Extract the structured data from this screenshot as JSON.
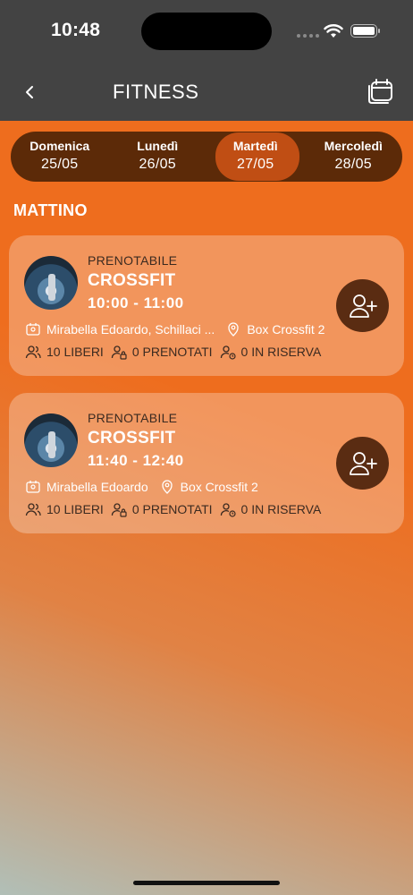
{
  "status_bar": {
    "time": "10:48"
  },
  "header": {
    "title": "FITNESS"
  },
  "days": [
    {
      "name": "Domenica",
      "date": "25/05",
      "active": false
    },
    {
      "name": "Lunedì",
      "date": "26/05",
      "active": false
    },
    {
      "name": "Martedì",
      "date": "27/05",
      "active": true
    },
    {
      "name": "Mercoledì",
      "date": "28/05",
      "active": false
    }
  ],
  "section": {
    "title": "MATTINO"
  },
  "classes": [
    {
      "status": "PRENOTABILE",
      "name": "CROSSFIT",
      "time": "10:00 - 11:00",
      "trainer": "Mirabella Edoardo, Schillaci ...",
      "location": "Box Crossfit 2",
      "free": "10 LIBERI",
      "booked": "0 PRENOTATI",
      "reserve": "0 IN RISERVA"
    },
    {
      "status": "PRENOTABILE",
      "name": "CROSSFIT",
      "time": "11:40 - 12:40",
      "trainer": "Mirabella Edoardo",
      "location": "Box Crossfit 2",
      "free": "10 LIBERI",
      "booked": "0 PRENOTATI",
      "reserve": "0 IN RISERVA"
    }
  ],
  "icons": {
    "back": "chevron-left-icon",
    "calendar": "calendar-icon",
    "trainer": "id-badge-icon",
    "location": "map-pin-icon",
    "free": "users-icon",
    "booked": "user-lock-icon",
    "reserve": "user-clock-icon",
    "add": "add-user-icon"
  },
  "colors": {
    "background": "#ee6d1e",
    "header": "#434343",
    "day_bar": "#5c2a08",
    "day_active": "#c04e14",
    "add_button": "#5a2c12"
  }
}
